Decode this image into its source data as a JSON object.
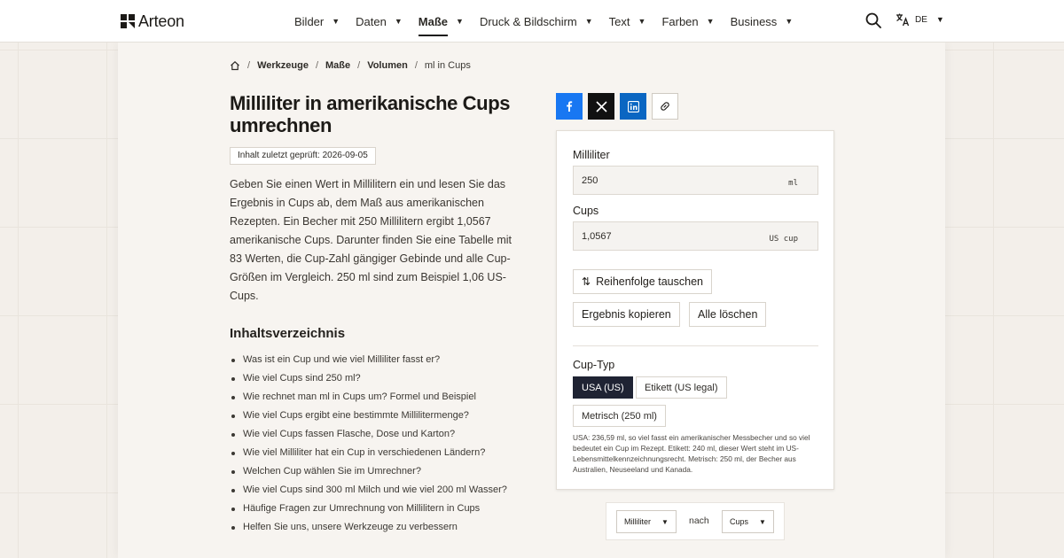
{
  "header": {
    "logo_text": "Arteon",
    "nav": [
      {
        "label": "Bilder",
        "active": false
      },
      {
        "label": "Daten",
        "active": false
      },
      {
        "label": "Maße",
        "active": true
      },
      {
        "label": "Druck & Bildschirm",
        "active": false
      },
      {
        "label": "Text",
        "active": false
      },
      {
        "label": "Farben",
        "active": false
      },
      {
        "label": "Business",
        "active": false
      }
    ],
    "lang": "DE"
  },
  "breadcrumb": {
    "items": [
      "Werkzeuge",
      "Maße",
      "Volumen"
    ],
    "current": "ml in Cups"
  },
  "page": {
    "title": "Milliliter in amerikanische Cups umrechnen",
    "reviewed": "Inhalt zuletzt geprüft: 2026-09-05",
    "intro": "Geben Sie einen Wert in Millilitern ein und lesen Sie das Ergebnis in Cups ab, dem Maß aus amerikanischen Rezepten. Ein Becher mit 250 Millilitern ergibt 1,0567 amerikanische Cups. Darunter finden Sie eine Tabelle mit 83 Werten, die Cup-Zahl gängiger Gebinde und alle Cup-Größen im Vergleich. 250 ml sind zum Beispiel 1,06 US-Cups.",
    "toc_heading": "Inhaltsverzeichnis",
    "toc": [
      "Was ist ein Cup und wie viel Milliliter fasst er?",
      "Wie viel Cups sind 250 ml?",
      "Wie rechnet man ml in Cups um? Formel und Beispiel",
      "Wie viel Cups ergibt eine bestimmte Millilitermenge?",
      "Wie viel Cups fassen Flasche, Dose und Karton?",
      "Wie viel Milliliter hat ein Cup in verschiedenen Ländern?",
      "Welchen Cup wählen Sie im Umrechner?",
      "Wie viel Cups sind 300 ml Milch und wie viel 200 ml Wasser?",
      "Häufige Fragen zur Umrechnung von Millilitern in Cups",
      "Helfen Sie uns, unsere Werkzeuge zu verbessern"
    ]
  },
  "converter": {
    "from_label": "Milliliter",
    "from_value": "250",
    "from_unit": "ml",
    "to_label": "Cups",
    "to_value": "1,0567",
    "to_unit": "US cup",
    "swap_label": "Reihenfolge tauschen",
    "copy_label": "Ergebnis kopieren",
    "clear_label": "Alle löschen",
    "cup_type_label": "Cup-Typ",
    "cup_types": [
      {
        "label": "USA (US)",
        "active": true
      },
      {
        "label": "Etikett (US legal)",
        "active": false
      },
      {
        "label": "Metrisch (250 ml)",
        "active": false
      }
    ],
    "note": "USA: 236,59 ml, so viel fasst ein amerikanischer Messbecher und so viel bedeutet ein Cup im Rezept. Etikett: 240 ml, dieser Wert steht im US-Lebensmittelkennzeichnungsrecht. Metrisch: 250 ml, der Becher aus Australien, Neuseeland und Kanada."
  },
  "unit_select": {
    "from": "Milliliter",
    "connector": "nach",
    "to": "Cups"
  }
}
